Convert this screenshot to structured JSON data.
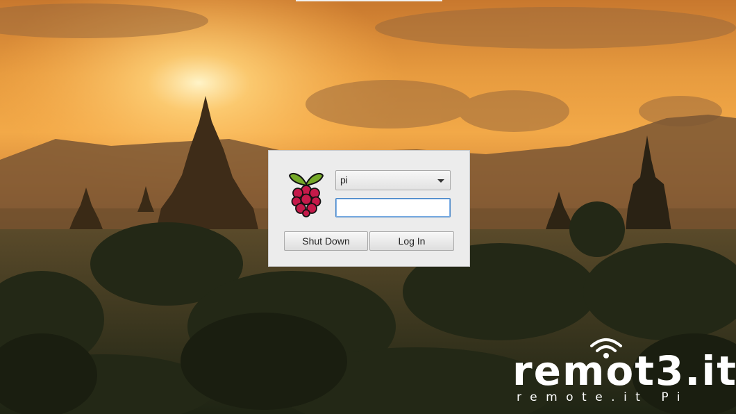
{
  "login": {
    "selected_user": "pi",
    "password_value": "",
    "shutdown_label": "Shut Down",
    "login_label": "Log In"
  },
  "branding": {
    "name": "remot3.it",
    "tagline": "remote.it Pi",
    "registered": "®"
  },
  "colors": {
    "raspberry_red": "#c51a4a",
    "leaf_green": "#75a928",
    "sky_orange": "#f3a541"
  },
  "icons": {
    "logo": "raspberry-pi-logo-icon",
    "dropdown": "chevron-down-icon",
    "brand_signal": "wifi-signal-icon"
  }
}
